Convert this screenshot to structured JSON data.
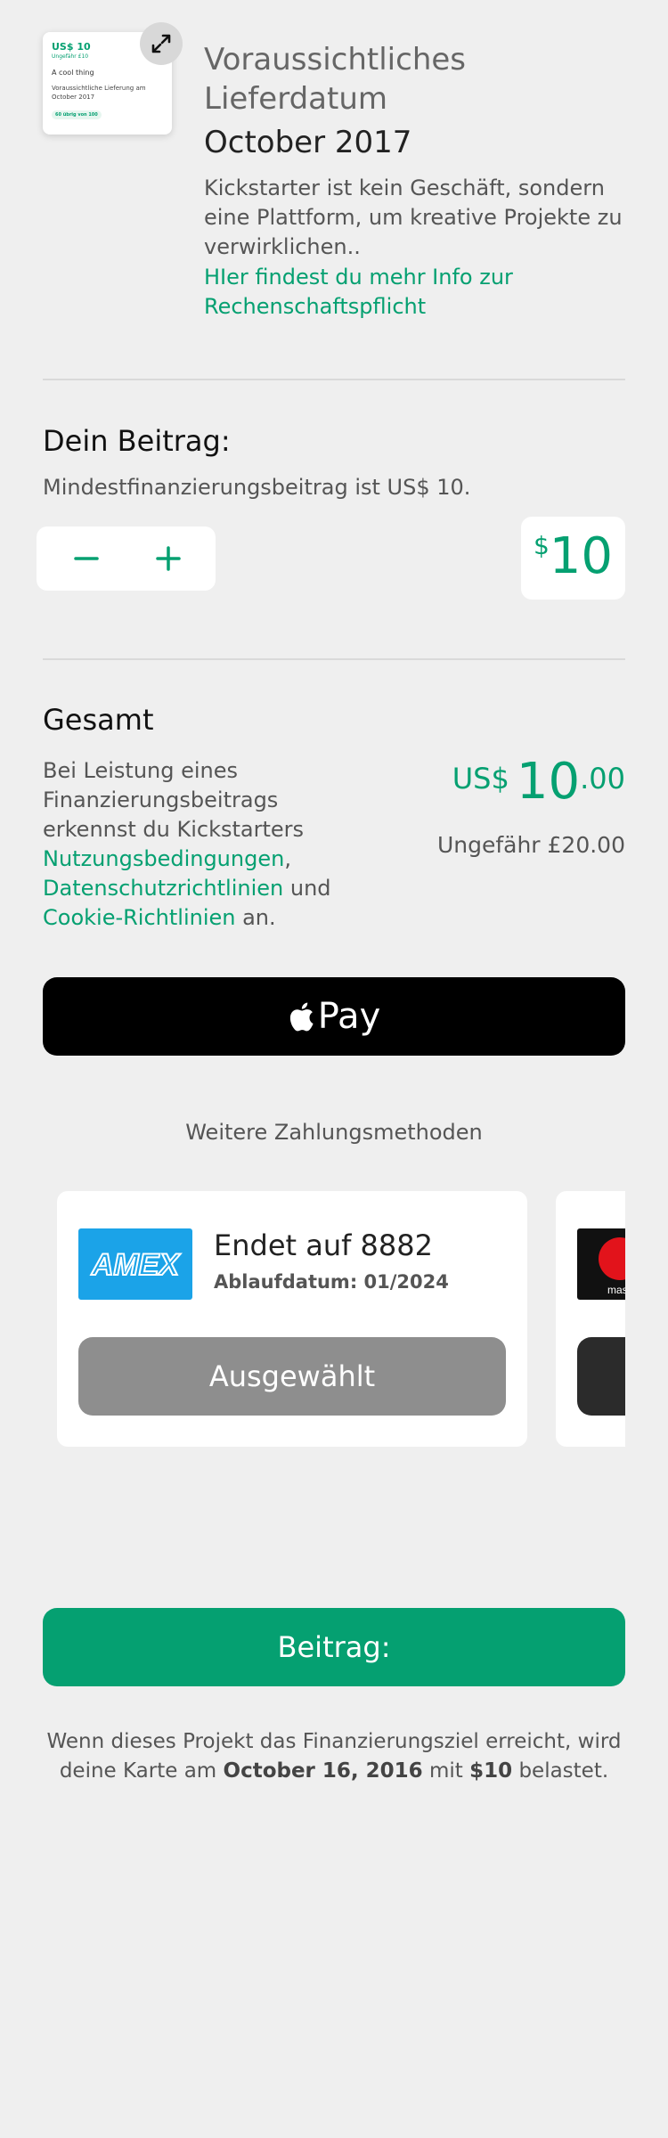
{
  "reward": {
    "amount": "US$ 10",
    "approx": "Ungefähr £10",
    "title": "A cool thing",
    "delivery": "Voraussichtliche Lieferung am October 2017",
    "badge": "60 übrig von 100",
    "expand_icon": "expand-arrows-icon"
  },
  "header": {
    "estimated_delivery_label": "Voraussichtliches Lieferdatum",
    "estimated_delivery_date": "October 2017",
    "description": "Kickstarter ist kein Geschäft, sondern eine Plattform, um kreative Projekte zu verwirklichen..",
    "accountability_link": "HIer findest du mehr Info zur Rechenschaftspflicht"
  },
  "pledge": {
    "title": "Dein Beitrag:",
    "minimum_text": "Mindestfinanzierungsbeitrag ist US$ 10.",
    "decrement_icon": "minus-icon",
    "increment_icon": "plus-icon",
    "currency_symbol": "$",
    "amount": "10"
  },
  "total": {
    "title": "Gesamt",
    "terms_prefix": "Bei Leistung eines Finanzierungsbeitrags erkennst du Kickstarters ",
    "terms_link": "Nutzungsbedingungen",
    "comma": ",",
    "privacy_link": "Datenschutzrichtlinien",
    "and_text": " und ",
    "cookie_link": "Cookie-Richtlinien",
    "suffix": " an.",
    "currency": "US$",
    "amount_whole": "10",
    "amount_cents": ".00",
    "approx": "Ungefähr £20.00"
  },
  "apple_pay": {
    "label": "Pay",
    "icon": "apple-logo-icon"
  },
  "payment_methods": {
    "title": "Weitere Zahlungsmethoden",
    "cards": [
      {
        "brand": "AMEX",
        "label": "Endet auf 8882",
        "expiry": "Ablaufdatum: 01/2024",
        "button": "Ausgewählt",
        "brand_color": "#1ba3e8",
        "button_color": "#8e8e8e"
      },
      {
        "brand": "mastercard",
        "label": "",
        "expiry": "",
        "button": "",
        "brand_color": "#111111",
        "button_color": "#2b2b2b"
      }
    ]
  },
  "cta": {
    "label": "Beitrag:",
    "color": "#05a071"
  },
  "footer": {
    "prefix": "Wenn dieses Projekt das Finanzierungsziel erreicht, wird deine Karte am ",
    "date": "October 16, 2016",
    "middle": " mit ",
    "amount": "$10",
    "suffix": " belastet."
  }
}
